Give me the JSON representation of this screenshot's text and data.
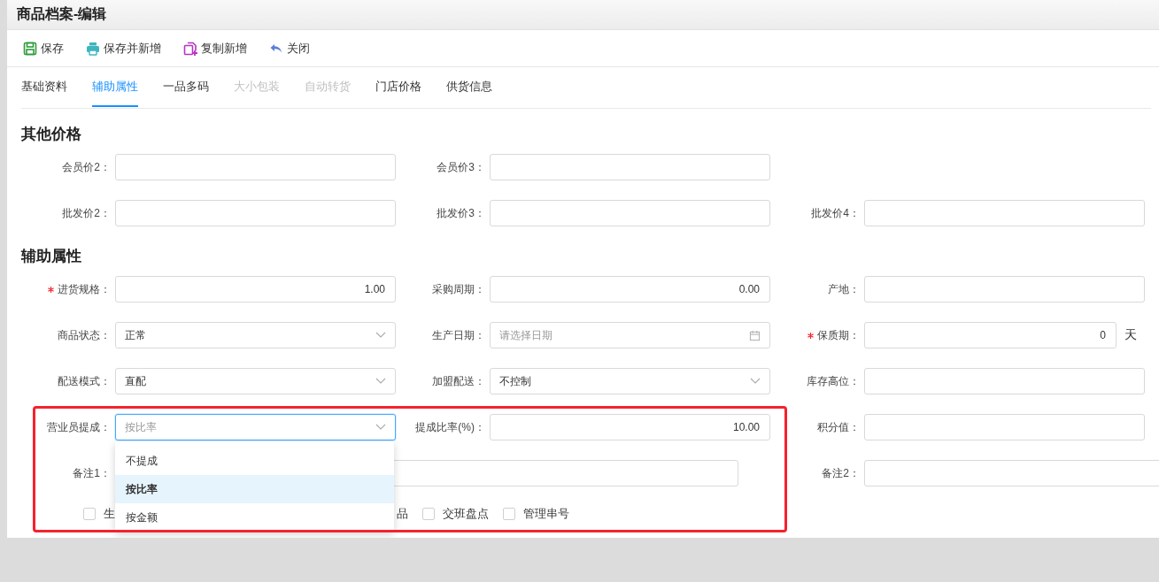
{
  "window": {
    "title": "商品档案-编辑"
  },
  "toolbar": [
    {
      "label": "保存"
    },
    {
      "label": "保存并新增"
    },
    {
      "label": "复制新增"
    },
    {
      "label": "关闭"
    }
  ],
  "tabs": [
    {
      "label": "基础资料",
      "selected": false,
      "disabled": false
    },
    {
      "label": "辅助属性",
      "selected": true,
      "disabled": false
    },
    {
      "label": "一品多码",
      "selected": false,
      "disabled": false
    },
    {
      "label": "大小包装",
      "selected": false,
      "disabled": true
    },
    {
      "label": "自动转货",
      "selected": false,
      "disabled": true
    },
    {
      "label": "门店价格",
      "selected": false,
      "disabled": false
    },
    {
      "label": "供货信息",
      "selected": false,
      "disabled": false
    }
  ],
  "sections": [
    {
      "title": "其他价格",
      "rows": [
        [
          {
            "label": "会员价2：",
            "kind": "text",
            "required": false
          },
          {
            "label": "会员价3：",
            "kind": "text",
            "required": false
          }
        ],
        [
          {
            "label": "批发价2：",
            "kind": "text",
            "required": false
          },
          {
            "label": "批发价3：",
            "kind": "text",
            "required": false
          },
          {
            "label": "批发价4：",
            "kind": "text",
            "required": false
          }
        ]
      ]
    },
    {
      "title": "辅助属性",
      "rows": [
        [
          {
            "label": "进货规格：",
            "kind": "number",
            "required": true,
            "value": "1.00"
          },
          {
            "label": "采购周期：",
            "kind": "number",
            "required": false,
            "value": "0.00"
          },
          {
            "label": "产地：",
            "kind": "text",
            "required": false
          }
        ],
        [
          {
            "label": "商品状态：",
            "kind": "select",
            "required": false,
            "value": "正常"
          },
          {
            "label": "生产日期：",
            "kind": "date",
            "required": false,
            "placeholder": "请选择日期"
          },
          {
            "label": "保质期：",
            "kind": "number",
            "required": true,
            "value": "0",
            "unit": "天"
          }
        ],
        [
          {
            "label": "配送模式：",
            "kind": "select",
            "required": false,
            "value": "直配"
          },
          {
            "label": "加盟配送：",
            "kind": "select",
            "required": false,
            "value": "不控制"
          },
          {
            "label": "库存高位：",
            "kind": "text",
            "required": false
          }
        ],
        [
          {
            "label": "营业员提成：",
            "kind": "select",
            "required": false,
            "placeholder": "按比率",
            "focused": true,
            "open": true,
            "options": [
              {
                "label": "不提成",
                "selected": false
              },
              {
                "label": "按比率",
                "selected": true
              },
              {
                "label": "按金额",
                "selected": false
              }
            ]
          },
          {
            "label": "提成比率(%)：",
            "kind": "number",
            "required": false,
            "value": "10.00"
          },
          {
            "label": "积分值：",
            "kind": "text",
            "required": false
          }
        ],
        [
          {
            "label": "备注1：",
            "kind": "wide",
            "required": false
          },
          "",
          {
            "label": "备注2：",
            "kind": "wide",
            "required": false
          }
        ]
      ],
      "checkboxes": [
        {
          "kind": "checkbox",
          "label": "生",
          "checked": false
        },
        {
          "kind": "fragment",
          "label": "品"
        },
        {
          "kind": "checkbox",
          "label": "交班盘点",
          "checked": false
        },
        {
          "kind": "checkbox",
          "label": "管理串号",
          "checked": false
        }
      ]
    }
  ],
  "highlight": {
    "kind": "rectangle"
  }
}
